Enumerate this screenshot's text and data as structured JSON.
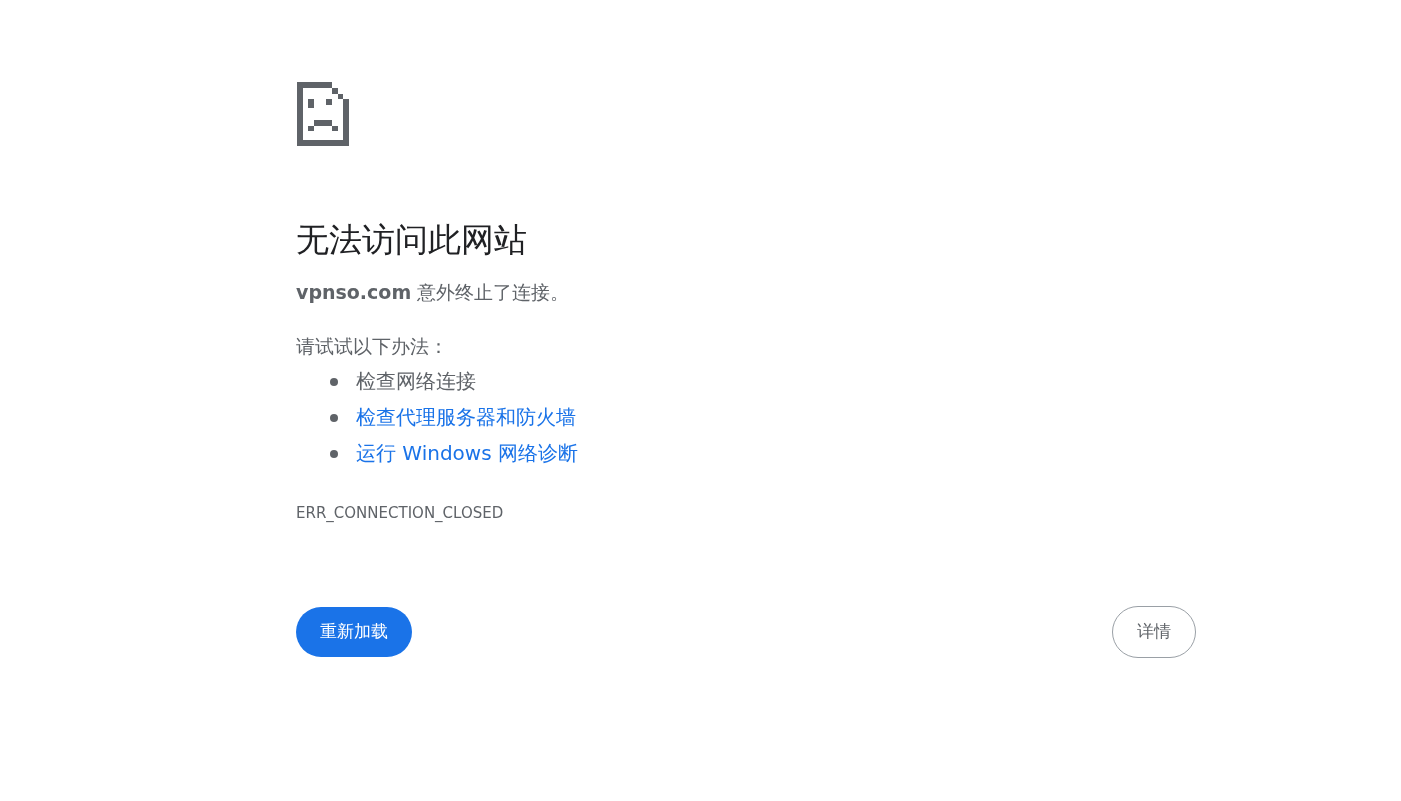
{
  "heading": "无法访问此网站",
  "message": "**vpnso.com** 意外终止了连接。",
  "suggestions_intro": "请试试以下办法：",
  "suggestions": [
    {
      "kind": "text",
      "label": "检查网络连接"
    },
    {
      "kind": "link",
      "label": "检查代理服务器和防火墙"
    },
    {
      "kind": "link",
      "label": "运行 Windows 网络诊断"
    }
  ],
  "error_code": "ERR_CONNECTION_CLOSED",
  "buttons": [
    {
      "kind": "primary",
      "label": "重新加载"
    },
    {
      "kind": "secondary",
      "label": "详情"
    }
  ]
}
